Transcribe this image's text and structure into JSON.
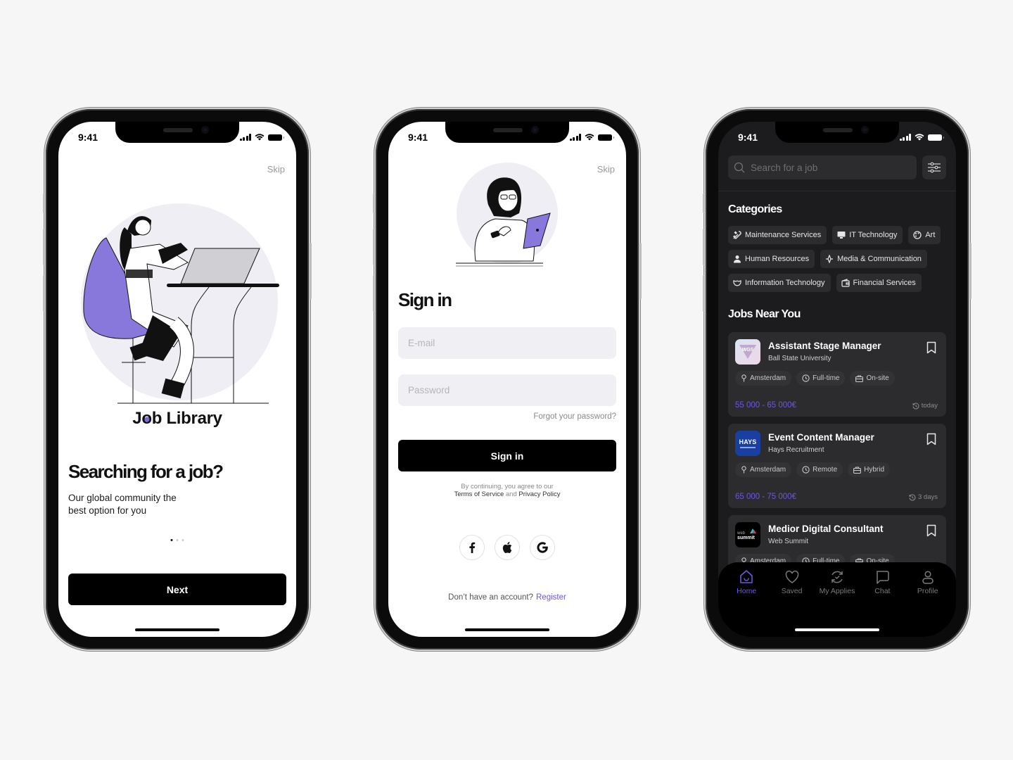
{
  "colors": {
    "accent": "#6a58e0",
    "illustration_purple": "#8878dc",
    "dark_bg": "#1c1c1e",
    "card_bg": "#2c2c2e"
  },
  "status_bar": {
    "time": "9:41"
  },
  "onboarding": {
    "skip_label": "Skip",
    "brand": {
      "before": "J",
      "o": "o",
      "after": "b Library"
    },
    "headline": "Searching for a job?",
    "subtitle": "Our global community the best option for you",
    "page_indicator": {
      "current": 1,
      "total": 3
    },
    "next_label": "Next"
  },
  "signin": {
    "skip_label": "Skip",
    "title": "Sign in",
    "email_placeholder": "E-mail",
    "password_placeholder": "Password",
    "forgot_label": "Forgot your password?",
    "signin_label": "Sign in",
    "legal_line1": "By continuing, you agree to our",
    "terms_label": "Terms of Service",
    "and_label": "and",
    "privacy_label": "Privacy Policy",
    "socials": [
      "facebook-icon",
      "apple-icon",
      "google-icon"
    ],
    "no_account_label": "Don’t have an account?",
    "register_label": "Register"
  },
  "home": {
    "search_placeholder": "Search for a job",
    "categories_title": "Categories",
    "categories": [
      {
        "label": "Maintenance Services",
        "icon": "tools-icon"
      },
      {
        "label": "IT Technology",
        "icon": "monitor-icon"
      },
      {
        "label": "Art",
        "icon": "palette-icon"
      },
      {
        "label": "Human Resources",
        "icon": "person-icon"
      },
      {
        "label": "Media & Communication",
        "icon": "signal-icon"
      },
      {
        "label": "Information Technology",
        "icon": "handshake-icon"
      },
      {
        "label": "Financial Services",
        "icon": "wallet-icon"
      }
    ],
    "jobs_title": "Jobs Near You",
    "jobs": [
      {
        "title": "Assistant Stage Manager",
        "company": "Ball State University",
        "logo_text": "WGS",
        "tags": [
          "Amsterdam",
          "Full-time",
          "On-site"
        ],
        "salary": "55 000 - 65 000€",
        "posted": "today"
      },
      {
        "title": "Event Content Manager",
        "company": "Hays Recruitment",
        "logo_text": "HAYS",
        "tags": [
          "Amsterdam",
          "Remote",
          "Hybrid"
        ],
        "salary": "65 000 - 75 000€",
        "posted": "3 days"
      },
      {
        "title": "Medior Digital Consultant",
        "company": "Web Summit",
        "logo_text": "web summit",
        "tags": [
          "Amsterdam",
          "Full-time",
          "On-site"
        ],
        "salary": "",
        "posted": ""
      }
    ],
    "tabs": [
      {
        "label": "Home",
        "icon": "home-icon",
        "active": true
      },
      {
        "label": "Saved",
        "icon": "heart-icon",
        "active": false
      },
      {
        "label": "My Applies",
        "icon": "refresh-check-icon",
        "active": false
      },
      {
        "label": "Chat",
        "icon": "chat-icon",
        "active": false
      },
      {
        "label": "Profile",
        "icon": "profile-icon",
        "active": false
      }
    ]
  }
}
